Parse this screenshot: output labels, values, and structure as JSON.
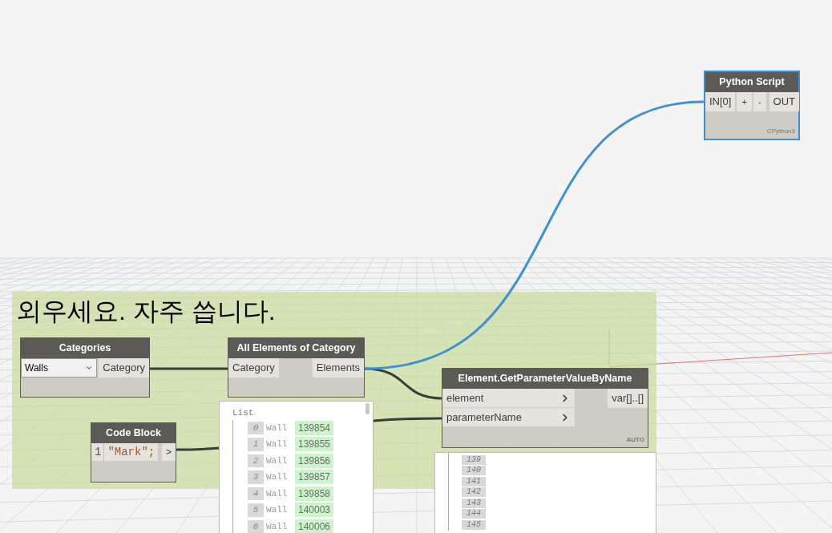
{
  "group": {
    "title": "외우세요. 자주 씁니다."
  },
  "nodes": [
    {
      "kind": "dropdown",
      "title": "Categories",
      "value": "Walls",
      "outputs": [
        "Category"
      ],
      "selected": false
    },
    {
      "kind": "standard",
      "title": "All Elements of Category",
      "inputs": [
        "Category"
      ],
      "input_chevrons": false,
      "outputs": [
        "Elements"
      ],
      "selected": false
    },
    {
      "kind": "code",
      "title": "Code Block",
      "line": "1",
      "code": "\"Mark\";",
      "outputs": [
        ">"
      ],
      "selected": false
    },
    {
      "kind": "standard",
      "title": "Element.GetParameterValueByName",
      "inputs": [
        "element",
        "parameterName"
      ],
      "input_chevrons": true,
      "outputs": [
        "var[]..[]"
      ],
      "lacing": "AUTO",
      "selected": false
    },
    {
      "kind": "python",
      "title": "Python Script",
      "inputs": [
        "IN[0]"
      ],
      "buttons": [
        "+",
        "-"
      ],
      "outputs": [
        "OUT"
      ],
      "engine": "CPython3",
      "selected": true
    }
  ],
  "preview_list": {
    "header": "List",
    "items": [
      {
        "index": "0",
        "type": "Wall",
        "id": "139854"
      },
      {
        "index": "1",
        "type": "Wall",
        "id": "139855"
      },
      {
        "index": "2",
        "type": "Wall",
        "id": "139856"
      },
      {
        "index": "3",
        "type": "Wall",
        "id": "139857"
      },
      {
        "index": "4",
        "type": "Wall",
        "id": "139858"
      },
      {
        "index": "5",
        "type": "Wall",
        "id": "140003"
      },
      {
        "index": "6",
        "type": "Wall",
        "id": "140006"
      }
    ]
  },
  "preview_indices": [
    "139",
    "140",
    "141",
    "142",
    "143",
    "144",
    "145"
  ]
}
